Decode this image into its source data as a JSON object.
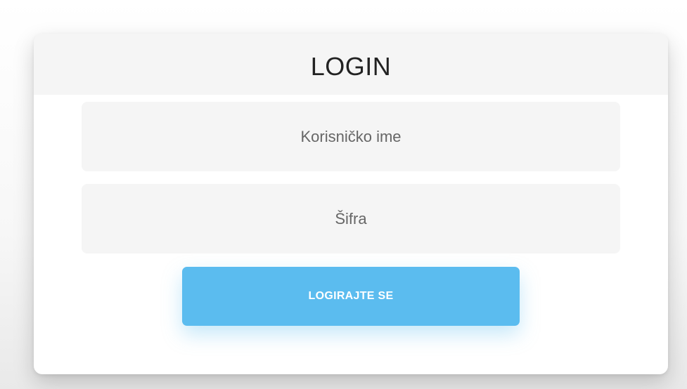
{
  "login_card": {
    "title": "LOGIN",
    "username_placeholder": "Korisničko ime",
    "password_placeholder": "Šifra",
    "submit_label": "LOGIRAJTE SE"
  },
  "colors": {
    "button_accent": "#5bbcef",
    "field_background": "#f5f5f5",
    "header_background": "#f5f5f5"
  }
}
